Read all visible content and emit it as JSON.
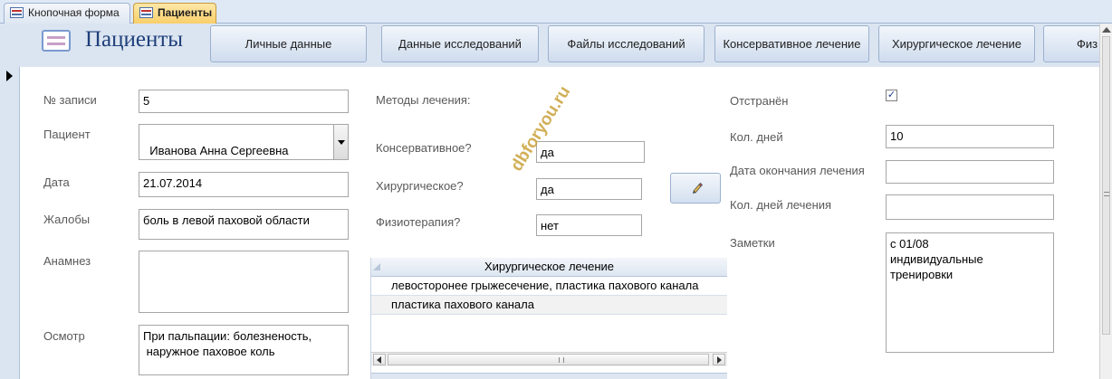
{
  "tabs": [
    {
      "label": "Кнопочная форма",
      "icon": "form-icon",
      "active": false
    },
    {
      "label": "Пациенты",
      "icon": "form-icon",
      "active": true
    }
  ],
  "header": {
    "title": "Пациенты",
    "nav_buttons": [
      "Личные данные",
      "Данные исследований",
      "Файлы исследований",
      "Консервативное лечение",
      "Хирургическое лечение",
      "Физ"
    ]
  },
  "form": {
    "record_no": {
      "label": "№ записи",
      "value": "5"
    },
    "patient": {
      "label": "Пациент",
      "value": "Иванова Анна Сергеевна"
    },
    "date": {
      "label": "Дата",
      "value": "21.07.2014"
    },
    "complaints": {
      "label": "Жалобы",
      "value": "боль в левой паховой области"
    },
    "anamnesis": {
      "label": "Анамнез",
      "value": ""
    },
    "exam": {
      "label": "Осмотр",
      "value": "При пальпации: болезненость,\n наружное паховое коль"
    },
    "methods_label": "Методы лечения:",
    "conservative": {
      "label": "Консервативное?",
      "value": "да"
    },
    "surgical": {
      "label": "Хирургическое?",
      "value": "да"
    },
    "physio": {
      "label": "Физиотерапия?",
      "value": "нет"
    },
    "removed": {
      "label": "Отстранён",
      "checked": true
    },
    "days": {
      "label": "Кол. дней",
      "value": "10"
    },
    "end_date": {
      "label": "Дата окончания лечения",
      "value": ""
    },
    "treatment_days": {
      "label": "Кол. дней лечения",
      "value": ""
    },
    "notes": {
      "label": "Заметки",
      "value": "с 01/08\nиндивидуальные\nтренировки"
    }
  },
  "subform": {
    "header": "Хирургическое лечение",
    "rows": [
      "левосторонее грыжесечение, пластика пахового канала",
      "пластика пахового канала"
    ]
  },
  "watermark": "dbforyou.ru"
}
